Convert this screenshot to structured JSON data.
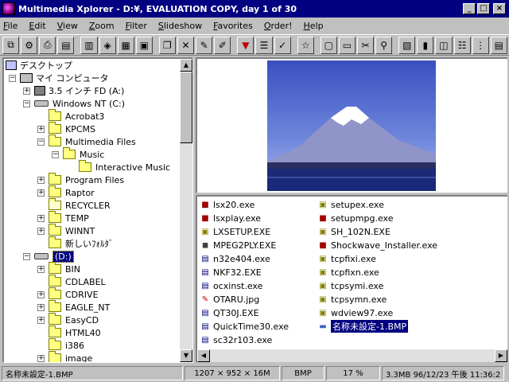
{
  "window": {
    "title": "Multimedia Xplorer - D:¥, EVALUATION COPY, day 1 of 30"
  },
  "menu": [
    "File",
    "Edit",
    "View",
    "Zoom",
    "Filter",
    "Slideshow",
    "Favorites",
    "Order!",
    "Help"
  ],
  "tree": {
    "items": [
      {
        "label": "デスクトップ",
        "icon": "desktop-icon"
      },
      {
        "label": "マイ コンピュータ",
        "icon": "computer-icon",
        "expander": "-"
      },
      {
        "label": "3.5 インチ FD (A:)",
        "icon": "floppy-icon",
        "expander": "+"
      },
      {
        "label": "Windows NT (C:)",
        "icon": "drive-icon",
        "expander": "-"
      },
      {
        "label": "Acrobat3",
        "icon": "folder-icon"
      },
      {
        "label": "KPCMS",
        "icon": "folder-icon",
        "expander": "+"
      },
      {
        "label": "Multimedia Files",
        "icon": "folder-icon",
        "expander": "-"
      },
      {
        "label": "Music",
        "icon": "folder-icon",
        "expander": "-"
      },
      {
        "label": "Interactive Music",
        "icon": "folder-icon"
      },
      {
        "label": "Program Files",
        "icon": "folder-icon",
        "expander": "+"
      },
      {
        "label": "Raptor",
        "icon": "folder-icon",
        "expander": "+"
      },
      {
        "label": "RECYCLER",
        "icon": "folder-icon"
      },
      {
        "label": "TEMP",
        "icon": "folder-icon",
        "expander": "+"
      },
      {
        "label": "WINNT",
        "icon": "folder-icon",
        "expander": "+"
      },
      {
        "label": "新しいﾌｫﾙﾀﾞ",
        "icon": "folder-icon"
      },
      {
        "label": "(D:)",
        "icon": "drive-icon",
        "expander": "-",
        "selected": true
      },
      {
        "label": "BIN",
        "icon": "folder-icon",
        "expander": "+"
      },
      {
        "label": "CDLABEL",
        "icon": "folder-icon"
      },
      {
        "label": "CDRIVE",
        "icon": "folder-icon",
        "expander": "+"
      },
      {
        "label": "EAGLE_NT",
        "icon": "folder-icon",
        "expander": "+"
      },
      {
        "label": "EasyCD",
        "icon": "folder-icon",
        "expander": "+"
      },
      {
        "label": "HTML40",
        "icon": "folder-icon"
      },
      {
        "label": "i386",
        "icon": "folder-icon"
      },
      {
        "label": "image",
        "icon": "folder-icon",
        "expander": "+"
      }
    ]
  },
  "files": {
    "col1": [
      {
        "name": "lsx20.exe",
        "icon": "package-icon"
      },
      {
        "name": "lsxplay.exe",
        "icon": "package-icon"
      },
      {
        "name": "LXSETUP.EXE",
        "icon": "setup-icon"
      },
      {
        "name": "MPEG2PLY.EXE",
        "icon": "app-icon"
      },
      {
        "name": "n32e404.exe",
        "icon": "exe-icon"
      },
      {
        "name": "NKF32.EXE",
        "icon": "exe-icon"
      },
      {
        "name": "ocxinst.exe",
        "icon": "exe-icon"
      },
      {
        "name": "OTARU.jpg",
        "icon": "image-icon"
      },
      {
        "name": "QT30J.EXE",
        "icon": "exe-icon"
      },
      {
        "name": "QuickTime30.exe",
        "icon": "exe-icon"
      },
      {
        "name": "sc32r103.exe",
        "icon": "exe-icon"
      }
    ],
    "col2": [
      {
        "name": "setupex.exe",
        "icon": "setup-icon"
      },
      {
        "name": "setupmpg.exe",
        "icon": "package-icon"
      },
      {
        "name": "SH_102N.EXE",
        "icon": "setup-icon"
      },
      {
        "name": "Shockwave_Installer.exe",
        "icon": "package-icon"
      },
      {
        "name": "tcpfixi.exe",
        "icon": "setup-icon"
      },
      {
        "name": "tcpfixn.exe",
        "icon": "setup-icon"
      },
      {
        "name": "tcpsymi.exe",
        "icon": "setup-icon"
      },
      {
        "name": "tcpsymn.exe",
        "icon": "setup-icon"
      },
      {
        "name": "wdview97.exe",
        "icon": "setup-icon"
      },
      {
        "name": "名称未設定-1.BMP",
        "icon": "bitmap-icon",
        "selected": true
      }
    ]
  },
  "status": {
    "filename": "名称未設定-1.BMP",
    "dimensions": "1207 × 952 × 16M",
    "format": "BMP",
    "zoom": "17 %",
    "info": "3.3MB 96/12/23 午後 11:36:2"
  },
  "colors": {
    "titlebar": "#000080",
    "selection": "#000080",
    "face": "#c0c0c0"
  }
}
